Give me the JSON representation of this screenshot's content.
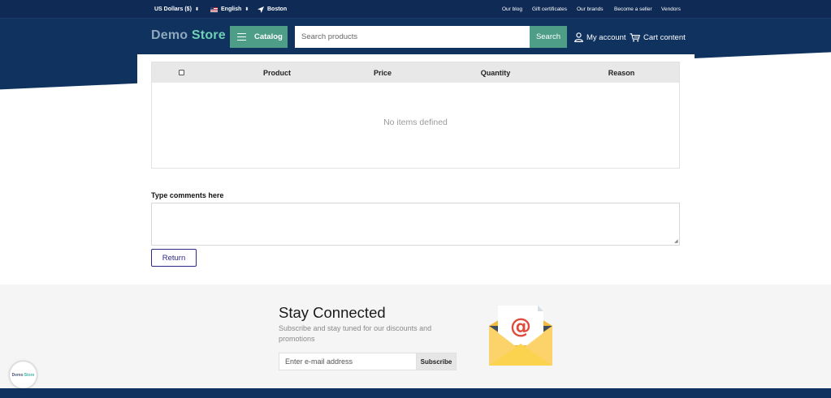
{
  "topbar": {
    "currency": "US Dollars ($)",
    "language": "English",
    "location": "Boston",
    "links": [
      "Our blog",
      "Gift certificates",
      "Our brands",
      "Become a seller",
      "Vendors"
    ]
  },
  "header": {
    "logo_part1": "Demo",
    "logo_part2": "Store",
    "catalog_label": "Catalog",
    "search_placeholder": "Search products",
    "search_button": "Search",
    "account_label": "My account",
    "cart_label": "Cart content"
  },
  "returns_table": {
    "columns": [
      "Product",
      "Price",
      "Quantity",
      "Reason"
    ],
    "empty_message": "No items defined"
  },
  "comments": {
    "label": "Type comments here",
    "value": ""
  },
  "return_button": "Return",
  "newsletter": {
    "title": "Stay Connected",
    "subtitle": "Subscribe and stay tuned for our discounts and promotions",
    "email_placeholder": "Enter e-mail address",
    "subscribe_button": "Subscribe"
  },
  "badge": {
    "part1": "Demo",
    "part2": "Store"
  },
  "colors": {
    "navy": "#10325f",
    "teal": "#4e9e87",
    "return_border": "#2c2a85"
  }
}
